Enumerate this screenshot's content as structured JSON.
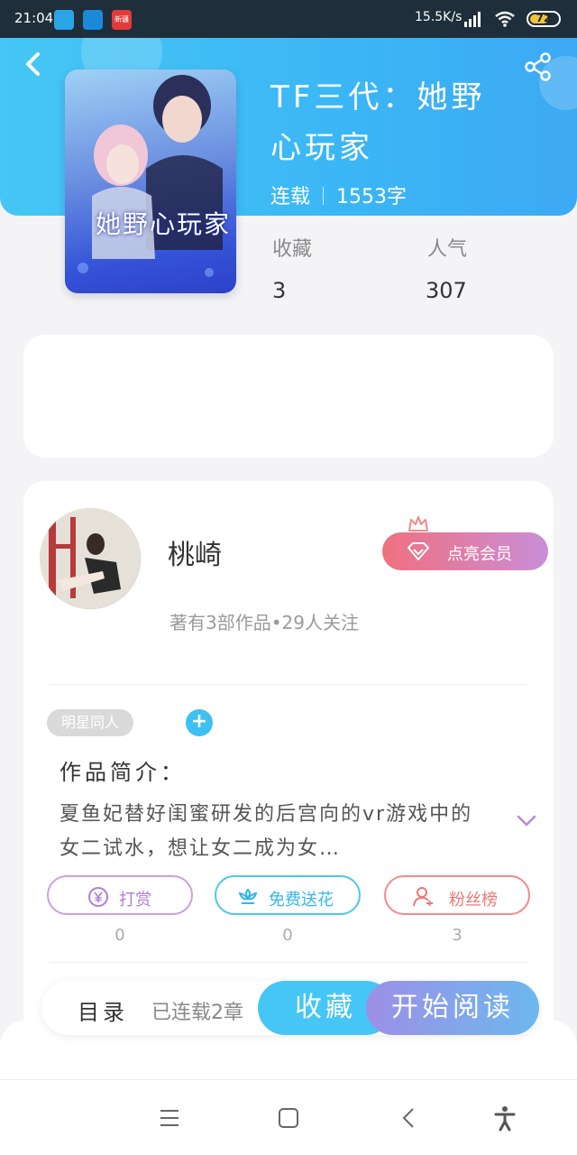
{
  "status_bar": {
    "time": "21:04",
    "app_badge": "新疆",
    "net_speed": "15.5K/s",
    "battery": "72",
    "battery_level": 0.72
  },
  "book": {
    "title": "TF三代：她野心玩家",
    "status": "连载",
    "word_count": "1553字",
    "cover_title": "她野心玩家",
    "stats": [
      {
        "label": "收藏",
        "value": "3"
      },
      {
        "label": "人气",
        "value": "307"
      }
    ]
  },
  "author": {
    "name": "桃崎",
    "vip_button": "点亮会员",
    "meta": "著有3部作品•29人关注"
  },
  "tags": {
    "items": [
      "明星同人"
    ],
    "add": "+"
  },
  "intro": {
    "label": "作品简介：",
    "text": "夏鱼妃替好闺蜜研发的后宫向的vr游戏中的女二试水，想让女二成为女…"
  },
  "actions": [
    {
      "label": "打赏",
      "count": "0",
      "icon": "yen-coin-icon"
    },
    {
      "label": "免费送花",
      "count": "0",
      "icon": "flower-icon"
    },
    {
      "label": "粉丝榜",
      "count": "3",
      "icon": "person-icon"
    }
  ],
  "bottom_bar": {
    "toc": "目录",
    "toc_status": "已连载2章",
    "favorite": "收藏",
    "start_reading": "开始阅读"
  },
  "colors": {
    "header": "#3bb6f5",
    "accent": "#45c6f4",
    "vip_gradient_start": "#f0707f",
    "vip_gradient_end": "#c98ed8"
  }
}
